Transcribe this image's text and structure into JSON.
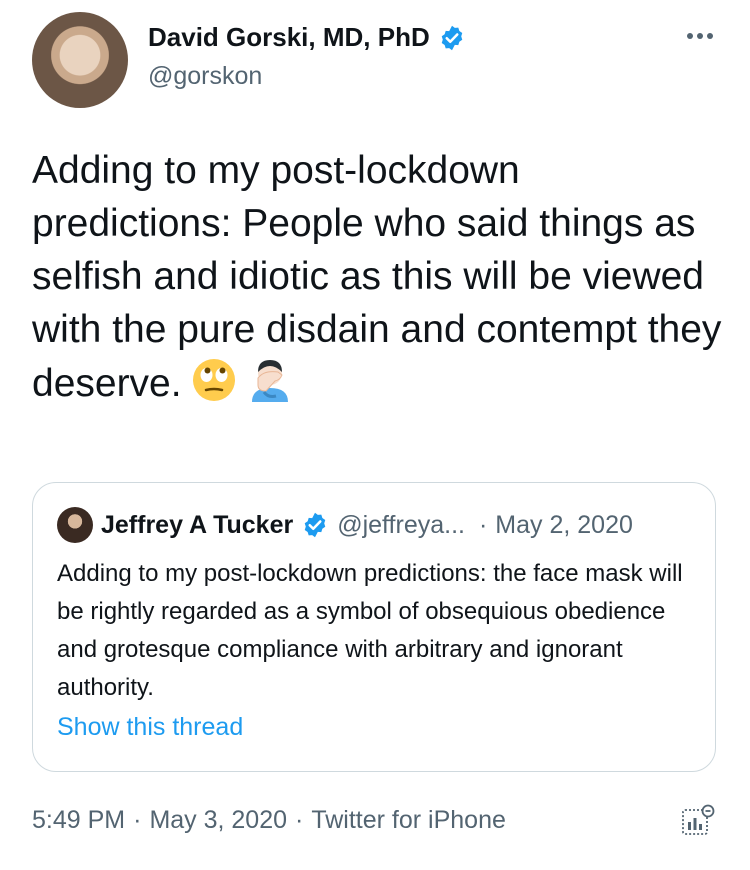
{
  "tweet": {
    "author_name": "David Gorski, MD, PhD",
    "handle": "@gorskon",
    "text": "Adding to my post-lockdown predictions: People who said things as selfish and idiotic as this will be viewed with the pure disdain and contempt they deserve.",
    "emojis": [
      "face-with-rolling-eyes",
      "person-facepalming"
    ],
    "time": "5:49 PM",
    "date": "May 3, 2020",
    "source": "Twitter for iPhone",
    "separator": "·"
  },
  "quoted_tweet": {
    "author_name": "Jeffrey A Tucker",
    "handle": "@jeffreya...",
    "separator": "·",
    "date": "May 2, 2020",
    "text": "Adding to my post-lockdown predictions: the face mask will be rightly regarded as a symbol of obsequious obedience and grotesque compliance with arbitrary and ignorant authority.",
    "link": "Show this thread"
  },
  "colors": {
    "verified": "#1d9bf0",
    "link": "#1d9bf0",
    "secondary_text": "#536471",
    "border": "#cfd9de"
  },
  "icons": [
    "verified-badge-icon",
    "more-options-icon",
    "analytics-icon"
  ]
}
